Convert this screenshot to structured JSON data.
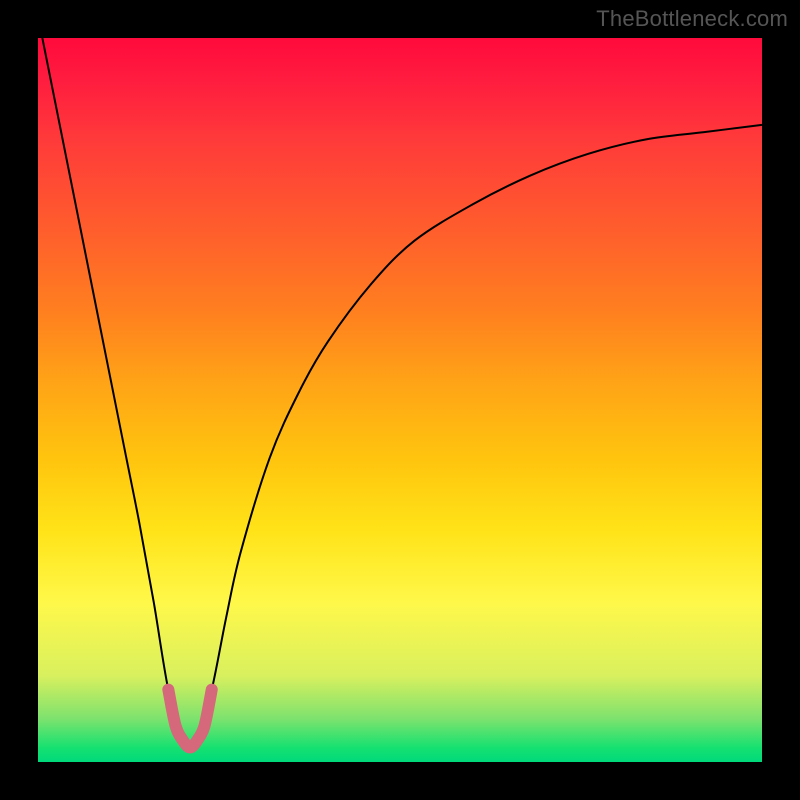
{
  "watermark": "TheBottleneck.com",
  "colors": {
    "frame": "#000000",
    "curve": "#000000",
    "marker": "#d5687a",
    "gradient_top": "#ff0a3c",
    "gradient_bottom": "#00d97b"
  },
  "chart_data": {
    "type": "line",
    "title": "",
    "xlabel": "",
    "ylabel": "",
    "xlim": [
      0,
      100
    ],
    "ylim": [
      0,
      100
    ],
    "grid": false,
    "legend": false,
    "x_optimal_range": [
      18,
      24
    ],
    "series": [
      {
        "name": "bottleneck-curve",
        "x": [
          0,
          4,
          8,
          12,
          14,
          16,
          18,
          20,
          21,
          22,
          24,
          26,
          28,
          32,
          36,
          40,
          46,
          52,
          60,
          68,
          76,
          84,
          92,
          100
        ],
        "y": [
          103,
          83,
          63,
          43,
          33,
          22,
          10,
          3,
          2,
          3,
          10,
          20,
          29,
          42,
          51,
          58,
          66,
          72,
          77,
          81,
          84,
          86,
          87,
          88
        ]
      }
    ],
    "marker": {
      "name": "u-highlight",
      "x": [
        18,
        19,
        20,
        21,
        22,
        23,
        24
      ],
      "y": [
        10,
        5,
        3,
        2,
        3,
        5,
        10
      ]
    }
  }
}
